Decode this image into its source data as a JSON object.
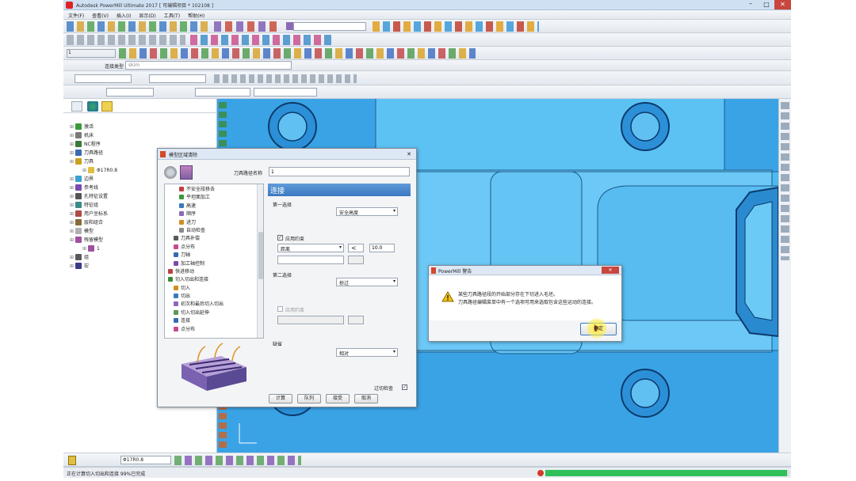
{
  "window": {
    "title": "Autodesk PowerMill Ultimate 2017   [ 可编辑项目 * 102108 ]"
  },
  "menu": [
    "文件(F)",
    "查看(V)",
    "插入(I)",
    "显示(D)",
    "工具(T)",
    "帮助(H)"
  ],
  "toolbar": {
    "drill_label": "钻孔",
    "layer_value": "1",
    "connect_type_label": "连接类型",
    "connect_type_value": "skim"
  },
  "explorer": {
    "items": [
      {
        "label": "激活",
        "icon": "activate-icon",
        "color": "#3a9a3a"
      },
      {
        "label": "机床",
        "icon": "machine-icon",
        "color": "#7a7a7a"
      },
      {
        "label": "NC程序",
        "icon": "nc-program-icon",
        "color": "#3a7a3a"
      },
      {
        "label": "刀具路径",
        "icon": "toolpath-icon",
        "color": "#3a6ab0"
      },
      {
        "label": "刀具",
        "icon": "tool-icon",
        "color": "#c9a020"
      },
      {
        "label": "Φ17R0.8",
        "icon": "tool-item-icon",
        "color": "#e0c040"
      },
      {
        "label": "边界",
        "icon": "boundary-icon",
        "color": "#3aa0d0"
      },
      {
        "label": "参考线",
        "icon": "pattern-icon",
        "color": "#7a4ab0"
      },
      {
        "label": "孔特征设置",
        "icon": "hole-icon",
        "color": "#555555"
      },
      {
        "label": "特征组",
        "icon": "feature-icon",
        "color": "#3a8a8a"
      },
      {
        "label": "用户坐标系",
        "icon": "ucs-icon",
        "color": "#b04a4a"
      },
      {
        "label": "层和组合",
        "icon": "layer-icon",
        "color": "#8a6a3a"
      },
      {
        "label": "模型",
        "icon": "model-icon",
        "color": "#b0b0b0"
      },
      {
        "label": "残留模型",
        "icon": "stock-model-icon",
        "color": "#a050a0"
      },
      {
        "label": "1",
        "icon": "stock-item-icon",
        "color": "#a050a0"
      },
      {
        "label": "组",
        "icon": "group-icon",
        "color": "#5a5a5a"
      },
      {
        "label": "宏",
        "icon": "macro-icon",
        "color": "#3a3a8a"
      }
    ]
  },
  "dialog": {
    "title": "模型区域清除",
    "toolpath_name_label": "刀具路径名称",
    "toolpath_name_value": "1",
    "tree": [
      "不安全段移去",
      "平坦面加工",
      "高速",
      "顺序",
      "进刀",
      "自动检查",
      "刀具补偿",
      "点分布",
      "刀轴",
      "加工轴控制",
      "快进移动",
      "切入切出和连接",
      "切入",
      "切出",
      "初次和最后切入切出",
      "切入切出延伸",
      "连接",
      "点分布"
    ],
    "section_title": "连接",
    "first_choice_label": "第一选择",
    "first_choice_value": "安全高度",
    "apply_constraint_label": "应用约束",
    "distance_label": "距离",
    "compare_op": "<",
    "distance_value": "10.0",
    "second_choice_label": "第二选择",
    "second_choice_value": "掠过",
    "apply_constraint2_label": "应用约束",
    "default_label": "缺省",
    "default_value": "相对",
    "gouge_check_label": "过切检查",
    "buttons": {
      "calculate": "计算",
      "queue": "队列",
      "accept": "接受",
      "cancel": "取消"
    }
  },
  "warning": {
    "title": "PowerMill 警告",
    "line1": "某些刀具路径段的开始部分存在下切进入毛坯。",
    "line2": "刀具路径编辑菜单中有一个选项可用来选取包含这些运动的连接。",
    "ok_label": "确定"
  },
  "bottom_toolbar": {
    "tool_value": "Φ17R0.8"
  },
  "status": {
    "text": "正在计算切入切出和连接  99%已完成",
    "progress": 0.99
  },
  "colors": {
    "viewport": "#4fb8f0",
    "viewport_dark": "#2c8fd6",
    "progress": "#2fc05a",
    "title_bar": "#cfe0f3"
  }
}
